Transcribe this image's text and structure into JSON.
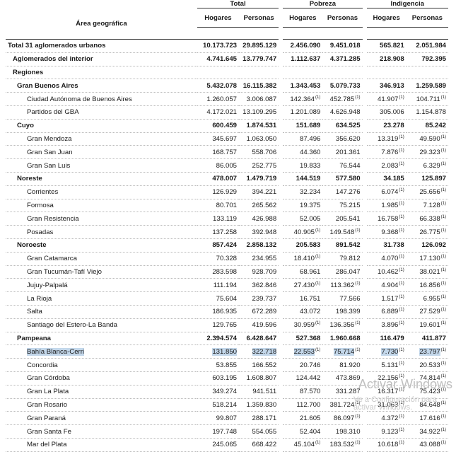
{
  "header": {
    "area_label": "Área geográfica",
    "groups": [
      "Total",
      "Pobreza",
      "Indigencia"
    ],
    "sub": [
      "Hogares",
      "Personas",
      "Hogares",
      "Personas",
      "Hogares",
      "Personas"
    ]
  },
  "rows": [
    {
      "name": "Total 31 aglomerados urbanos",
      "level": 0,
      "bold": true,
      "vals": [
        "10.173.723",
        "29.895.129",
        "2.456.090",
        "9.451.018",
        "565.821",
        "2.051.984"
      ],
      "marks": [
        "",
        "",
        "",
        "",
        "",
        ""
      ]
    },
    {
      "name": "Aglomerados del interior",
      "level": 1,
      "bold": true,
      "vals": [
        "4.741.645",
        "13.779.747",
        "1.112.637",
        "4.371.285",
        "218.908",
        "792.395"
      ],
      "marks": [
        "",
        "",
        "",
        "",
        "",
        ""
      ]
    },
    {
      "name": "Regiones",
      "level": 1,
      "bold": true,
      "vals": [
        "",
        "",
        "",
        "",
        "",
        ""
      ],
      "marks": [
        "",
        "",
        "",
        "",
        "",
        ""
      ]
    },
    {
      "name": "Gran Buenos Aires",
      "level": 2,
      "bold": true,
      "vals": [
        "5.432.078",
        "16.115.382",
        "1.343.453",
        "5.079.733",
        "346.913",
        "1.259.589"
      ],
      "marks": [
        "",
        "",
        "",
        "",
        "",
        ""
      ]
    },
    {
      "name": "Ciudad Autónoma de Buenos Aires",
      "level": 4,
      "bold": false,
      "vals": [
        "1.260.057",
        "3.006.087",
        "142.364",
        "452.785",
        "41.907",
        "104.711"
      ],
      "marks": [
        "",
        "",
        "(1)",
        "(1)",
        "(1)",
        "(1)"
      ]
    },
    {
      "name": "Partidos del GBA",
      "level": 4,
      "bold": false,
      "vals": [
        "4.172.021",
        "13.109.295",
        "1.201.089",
        "4.626.948",
        "305.006",
        "1.154.878"
      ],
      "marks": [
        "",
        "",
        "",
        "",
        "",
        ""
      ]
    },
    {
      "name": "Cuyo",
      "level": 2,
      "bold": true,
      "vals": [
        "600.459",
        "1.874.531",
        "151.689",
        "634.525",
        "23.278",
        "85.242"
      ],
      "marks": [
        "",
        "",
        "",
        "",
        "",
        ""
      ]
    },
    {
      "name": "Gran Mendoza",
      "level": 4,
      "bold": false,
      "vals": [
        "345.697",
        "1.063.050",
        "87.496",
        "356.620",
        "13.319",
        "49.590"
      ],
      "marks": [
        "",
        "",
        "",
        "",
        "(1)",
        "(1)"
      ]
    },
    {
      "name": "Gran San Juan",
      "level": 4,
      "bold": false,
      "vals": [
        "168.757",
        "558.706",
        "44.360",
        "201.361",
        "7.876",
        "29.323"
      ],
      "marks": [
        "",
        "",
        "",
        "",
        "(1)",
        "(1)"
      ]
    },
    {
      "name": "Gran San Luis",
      "level": 4,
      "bold": false,
      "vals": [
        "86.005",
        "252.775",
        "19.833",
        "76.544",
        "2.083",
        "6.329"
      ],
      "marks": [
        "",
        "",
        "",
        "",
        "(1)",
        "(1)"
      ]
    },
    {
      "name": "Noreste",
      "level": 2,
      "bold": true,
      "vals": [
        "478.007",
        "1.479.719",
        "144.519",
        "577.580",
        "34.185",
        "125.897"
      ],
      "marks": [
        "",
        "",
        "",
        "",
        "",
        ""
      ]
    },
    {
      "name": "Corrientes",
      "level": 4,
      "bold": false,
      "vals": [
        "126.929",
        "394.221",
        "32.234",
        "147.276",
        "6.074",
        "25.656"
      ],
      "marks": [
        "",
        "",
        "",
        "",
        "(1)",
        "(1)"
      ]
    },
    {
      "name": "Formosa",
      "level": 4,
      "bold": false,
      "vals": [
        "80.701",
        "265.562",
        "19.375",
        "75.215",
        "1.985",
        "7.128"
      ],
      "marks": [
        "",
        "",
        "",
        "",
        "(1)",
        "(1)"
      ]
    },
    {
      "name": "Gran Resistencia",
      "level": 4,
      "bold": false,
      "vals": [
        "133.119",
        "426.988",
        "52.005",
        "205.541",
        "16.758",
        "66.338"
      ],
      "marks": [
        "",
        "",
        "",
        "",
        "(1)",
        "(1)"
      ]
    },
    {
      "name": "Posadas",
      "level": 4,
      "bold": false,
      "vals": [
        "137.258",
        "392.948",
        "40.905",
        "149.548",
        "9.368",
        "26.775"
      ],
      "marks": [
        "",
        "",
        "(1)",
        "(1)",
        "(1)",
        "(1)"
      ]
    },
    {
      "name": "Noroeste",
      "level": 2,
      "bold": true,
      "vals": [
        "857.424",
        "2.858.132",
        "205.583",
        "891.542",
        "31.738",
        "126.092"
      ],
      "marks": [
        "",
        "",
        "",
        "",
        "",
        ""
      ]
    },
    {
      "name": "Gran Catamarca",
      "level": 4,
      "bold": false,
      "vals": [
        "70.328",
        "234.955",
        "18.410",
        "79.812",
        "4.070",
        "17.130"
      ],
      "marks": [
        "",
        "",
        "(1)",
        "",
        "(1)",
        "(1)"
      ]
    },
    {
      "name": "Gran Tucumán-Tafí Viejo",
      "level": 4,
      "bold": false,
      "vals": [
        "283.598",
        "928.709",
        "68.961",
        "286.047",
        "10.462",
        "38.021"
      ],
      "marks": [
        "",
        "",
        "",
        "",
        "(1)",
        "(1)"
      ]
    },
    {
      "name": "Jujuy-Palpalá",
      "level": 4,
      "bold": false,
      "vals": [
        "111.194",
        "362.846",
        "27.430",
        "113.362",
        "4.904",
        "16.856"
      ],
      "marks": [
        "",
        "",
        "(1)",
        "(1)",
        "(1)",
        "(1)"
      ]
    },
    {
      "name": "La Rioja",
      "level": 4,
      "bold": false,
      "vals": [
        "75.604",
        "239.737",
        "16.751",
        "77.566",
        "1.517",
        "6.955"
      ],
      "marks": [
        "",
        "",
        "",
        "",
        "(1)",
        "(1)"
      ]
    },
    {
      "name": "Salta",
      "level": 4,
      "bold": false,
      "vals": [
        "186.935",
        "672.289",
        "43.072",
        "198.399",
        "6.889",
        "27.529"
      ],
      "marks": [
        "",
        "",
        "",
        "",
        "(1)",
        "(1)"
      ]
    },
    {
      "name": "Santiago del Estero-La Banda",
      "level": 4,
      "bold": false,
      "vals": [
        "129.765",
        "419.596",
        "30.959",
        "136.356",
        "3.896",
        "19.601"
      ],
      "marks": [
        "",
        "",
        "(1)",
        "(1)",
        "(1)",
        "(1)"
      ]
    },
    {
      "name": "Pampeana",
      "level": 2,
      "bold": true,
      "vals": [
        "2.394.574",
        "6.428.647",
        "527.368",
        "1.960.668",
        "116.479",
        "411.877"
      ],
      "marks": [
        "",
        "",
        "",
        "",
        "",
        ""
      ]
    },
    {
      "name": "Bahía Blanca-Cerri",
      "level": 4,
      "bold": false,
      "selected": true,
      "vals": [
        "131.850",
        "322.718",
        "22.553",
        "75.714",
        "7.730",
        "23.797"
      ],
      "marks": [
        "",
        "",
        "(1)",
        "(1)",
        "(1)",
        "(1)"
      ]
    },
    {
      "name": "Concordia",
      "level": 4,
      "bold": false,
      "vals": [
        "53.855",
        "166.552",
        "20.746",
        "81.920",
        "5.131",
        "20.533"
      ],
      "marks": [
        "",
        "",
        "",
        "",
        "(1)",
        "(1)"
      ]
    },
    {
      "name": "Gran Córdoba",
      "level": 4,
      "bold": false,
      "vals": [
        "603.195",
        "1.608.807",
        "124.442",
        "473.869",
        "22.156",
        "74.814"
      ],
      "marks": [
        "",
        "",
        "",
        "",
        "(1)",
        "(1)"
      ]
    },
    {
      "name": "Gran La Plata",
      "level": 4,
      "bold": false,
      "vals": [
        "349.274",
        "941.511",
        "87.570",
        "331.287",
        "16.317",
        "75.423"
      ],
      "marks": [
        "",
        "",
        "",
        "",
        "(1)",
        "(1)"
      ]
    },
    {
      "name": "Gran Rosario",
      "level": 4,
      "bold": false,
      "vals": [
        "518.214",
        "1.359.830",
        "112.700",
        "381.724",
        "31.063",
        "84.648"
      ],
      "marks": [
        "",
        "",
        "",
        "(1)",
        "(1)",
        "(1)"
      ]
    },
    {
      "name": "Gran Paraná",
      "level": 4,
      "bold": false,
      "vals": [
        "99.807",
        "288.171",
        "21.605",
        "86.097",
        "4.372",
        "17.616"
      ],
      "marks": [
        "",
        "",
        "",
        "(1)",
        "(1)",
        "(1)"
      ]
    },
    {
      "name": "Gran Santa Fe",
      "level": 4,
      "bold": false,
      "vals": [
        "197.748",
        "554.055",
        "52.404",
        "198.310",
        "9.123",
        "34.922"
      ],
      "marks": [
        "",
        "",
        "",
        "",
        "(1)",
        "(1)"
      ]
    },
    {
      "name": "Mar del Plata",
      "level": 4,
      "bold": false,
      "vals": [
        "245.065",
        "668.422",
        "45.104",
        "183.532",
        "10.618",
        "43.088"
      ],
      "marks": [
        "",
        "",
        "(1)",
        "(1)",
        "(1)",
        "(1)"
      ]
    }
  ],
  "watermark": {
    "line1": "Activar Windows",
    "line2": "Ve a Configuración para activar Windows."
  }
}
